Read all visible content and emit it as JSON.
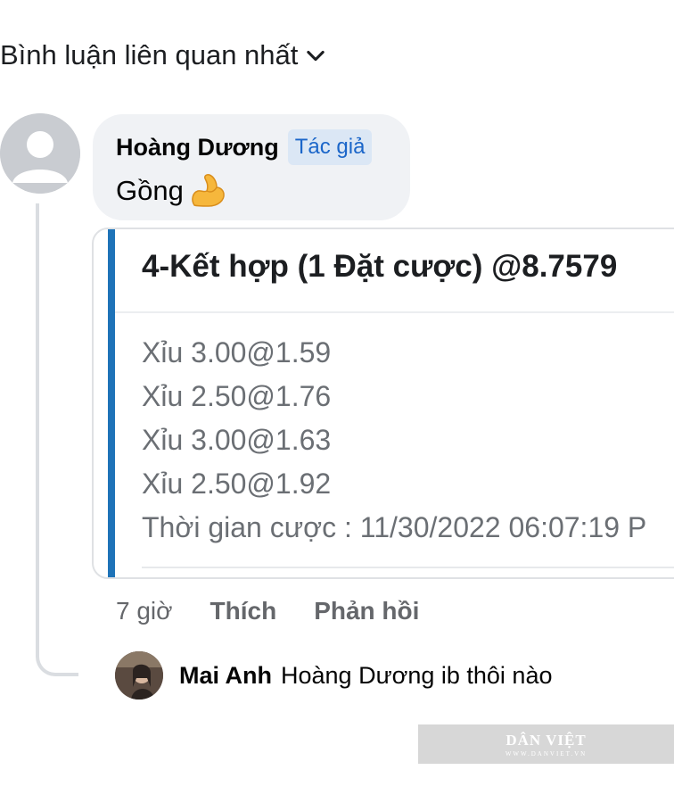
{
  "sort": {
    "label": "Bình luận liên quan nhất",
    "icon": "chevron-down-icon"
  },
  "comment": {
    "author": "Hoàng Dương",
    "badge": "Tác giả",
    "text": "Gồng",
    "emoji": "flexed-biceps-icon"
  },
  "bet_card": {
    "title": "4-Kết hợp (1 Đặt cược) @8.7579",
    "lines": [
      "Xỉu 3.00@1.59",
      "Xỉu 2.50@1.76",
      "Xỉu 3.00@1.63",
      "Xỉu 2.50@1.92",
      "Thời gian cược : 11/30/2022 06:07:19 P"
    ]
  },
  "actions": {
    "time": "7 giờ",
    "like": "Thích",
    "reply": "Phản hồi"
  },
  "reply": {
    "author": "Mai Anh",
    "text": "Hoàng Dương ib thôi nào"
  },
  "watermark": {
    "main": "DÂN VIỆT",
    "sub": "WWW.DANVIET.VN"
  },
  "colors": {
    "accent_bar": "#1e73b8",
    "badge_bg": "#dbe7f5",
    "badge_text": "#1b66c9",
    "bubble_bg": "#f0f2f5",
    "muted_text": "#65676b"
  }
}
